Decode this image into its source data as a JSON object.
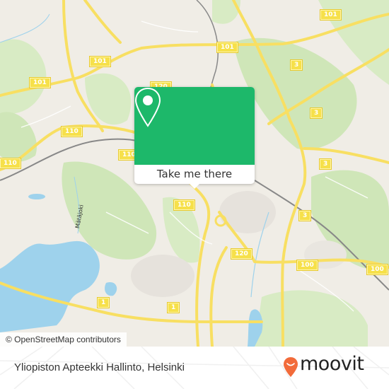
{
  "map": {
    "popup": {
      "button_label": "Take me there",
      "pin_icon": "map-pin-icon",
      "accent_color": "#1db86a"
    },
    "attribution": "© OpenStreetMap contributors",
    "water_labels": [
      "Mätäjoki"
    ],
    "road_shields": [
      {
        "id": "101-a",
        "label": "101"
      },
      {
        "id": "101-b",
        "label": "101"
      },
      {
        "id": "101-c",
        "label": "101"
      },
      {
        "id": "101-d",
        "label": "101"
      },
      {
        "id": "120-a",
        "label": "120"
      },
      {
        "id": "120-b",
        "label": "120"
      },
      {
        "id": "110-a",
        "label": "110"
      },
      {
        "id": "110-b",
        "label": "110"
      },
      {
        "id": "110-c",
        "label": "110"
      },
      {
        "id": "110-d",
        "label": "110"
      },
      {
        "id": "3-a",
        "label": "3"
      },
      {
        "id": "3-b",
        "label": "3"
      },
      {
        "id": "3-c",
        "label": "3"
      },
      {
        "id": "3-d",
        "label": "3"
      },
      {
        "id": "100-a",
        "label": "100"
      },
      {
        "id": "100-b",
        "label": "100"
      },
      {
        "id": "1-a",
        "label": "1"
      },
      {
        "id": "1-b",
        "label": "1"
      }
    ]
  },
  "footer": {
    "place_name": "Yliopiston Apteekki Hallinto, Helsinki",
    "brand": "moovit",
    "brand_color": "#f26b3a"
  }
}
